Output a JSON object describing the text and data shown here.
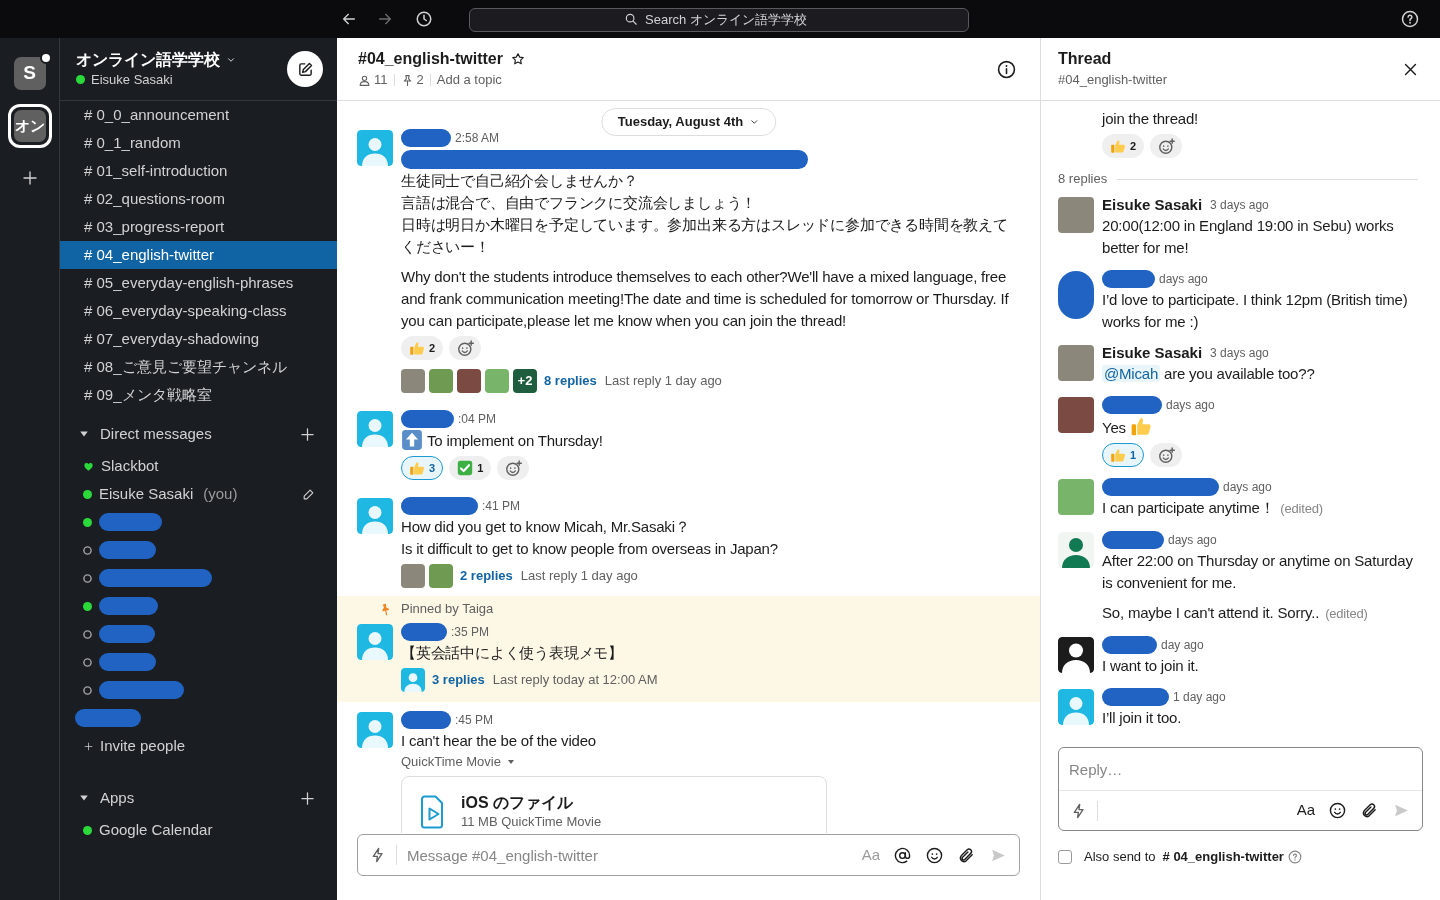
{
  "top_bar": {
    "search": {
      "placeholder": "Search オンライン語学学校"
    }
  },
  "workspace_rail": {
    "workspaces": [
      {
        "label": "S",
        "selected": false,
        "unread": true
      },
      {
        "label": "オン",
        "selected": true,
        "unread": false
      }
    ]
  },
  "sidebar": {
    "workspace_name": "オンライン語学学校",
    "user": {
      "name": "Eisuke Sasaki",
      "online": true
    },
    "channels": [
      {
        "label": "# 0_0_announcement",
        "selected": false
      },
      {
        "label": "# 0_1_random",
        "selected": false
      },
      {
        "label": "# 01_self-introduction",
        "selected": false
      },
      {
        "label": "# 02_questions-room",
        "selected": false
      },
      {
        "label": "# 03_progress-report",
        "selected": false
      },
      {
        "label": "# 04_english-twitter",
        "selected": true
      },
      {
        "label": "# 05_everyday-english-phrases",
        "selected": false
      },
      {
        "label": "# 06_everyday-speaking-class",
        "selected": false
      },
      {
        "label": "# 07_everyday-shadowing",
        "selected": false
      },
      {
        "label": "# 08_ご意見ご要望チャンネル",
        "selected": false
      },
      {
        "label": "# 09_メンタ戦略室",
        "selected": false
      }
    ],
    "sections": [
      {
        "title": "Direct messages",
        "expanded": true,
        "items": [
          {
            "kind": "bot",
            "name": "Slackbot"
          },
          {
            "kind": "self",
            "name": "Eisuke Sasaki",
            "suffix": "(you)",
            "online": true
          },
          {
            "kind": "member",
            "redacted": true,
            "online": true
          },
          {
            "kind": "member",
            "redacted": true,
            "online": false
          },
          {
            "kind": "member",
            "redacted": true,
            "online": false
          },
          {
            "kind": "member",
            "redacted": true,
            "online": true
          },
          {
            "kind": "member",
            "redacted": true,
            "online": false
          },
          {
            "kind": "member",
            "redacted": true,
            "online": false
          },
          {
            "kind": "member",
            "redacted": true,
            "online": false
          },
          {
            "kind": "member",
            "redacted": true
          }
        ],
        "footer": "Invite people"
      },
      {
        "title": "Apps",
        "expanded": true,
        "items": [
          {
            "kind": "app",
            "name": "Google Calendar",
            "online": true
          }
        ]
      }
    ]
  },
  "channel": {
    "name": "#04_english-twitter",
    "starred": false,
    "members": "11",
    "pins": "2",
    "topic": "Add a topic",
    "date": "Tuesday, August 4th",
    "messages": [
      {
        "avatar": {
          "kind": "default"
        },
        "author_redacted": true,
        "time": "2:58 AM",
        "mentions_redacted": true,
        "paragraphs": [
          {
            "lines": [
              "生徒同士で自己紹介会しませんか？",
              "言語は混合で、自由でフランクに交流会しましょう！",
              "日時は明日か木曜日を予定しています。参加出来る方はスレッドに参加できる時間を教えてくださいー！"
            ]
          },
          {
            "text": "Why don't the students introduce themselves to each other?We'll have a mixed language, free and frank communication meeting!The date and time is scheduled for tomorrow or Thursday. If you can participate,please let me know when you can join the thread!"
          }
        ],
        "reactions": [
          {
            "kind": "thumbs-up",
            "count": "2",
            "selected": false
          }
        ],
        "thread": {
          "avatars": [
            {
              "kind": "photo"
            },
            {
              "kind": "photo"
            },
            {
              "kind": "photo"
            },
            {
              "kind": "photo"
            }
          ],
          "more": "+2",
          "replies": "8 replies",
          "last_reply": "Last reply 1 day ago"
        }
      },
      {
        "avatar": {
          "kind": "default"
        },
        "author_redacted": true,
        "time": ":04 PM",
        "paragraphs": [
          {
            "emoji_before": {
              "kind": "up-arrow"
            },
            "text": "To implement on Thursday!"
          }
        ],
        "reactions": [
          {
            "kind": "thumbs-up",
            "count": "3",
            "selected": true
          },
          {
            "kind": "check-box",
            "count": "1",
            "selected": false
          }
        ]
      },
      {
        "avatar": {
          "kind": "default"
        },
        "author_redacted": true,
        "time": ":41 PM",
        "paragraphs": [
          {
            "lines": [
              "How did you get to know Micah, Mr.Sasaki？",
              "Is it difficult to get to know people from overseas in Japan?"
            ]
          }
        ],
        "thread": {
          "avatars": [
            {
              "kind": "photo"
            },
            {
              "kind": "photo"
            }
          ],
          "replies": "2 replies",
          "last_reply": "Last reply 1 day ago"
        }
      },
      {
        "pinned_by": "Pinned by Taiga",
        "avatar": {
          "kind": "default"
        },
        "author_redacted": true,
        "time": ":35 PM",
        "paragraphs": [
          {
            "text": "【英会話中によく使う表現メモ】"
          }
        ],
        "thread": {
          "avatars": [
            {
              "kind": "default"
            }
          ],
          "replies": "3 replies",
          "last_reply": "Last reply today at 12:00 AM"
        }
      },
      {
        "avatar": {
          "kind": "default"
        },
        "author_redacted": true,
        "time": ":45 PM",
        "paragraphs": [
          {
            "text": "I can't hear the be of the video"
          }
        ],
        "file": {
          "caption": "QuickTime Movie",
          "name": "iOS のファイル",
          "meta": "11 MB QuickTime Movie"
        }
      }
    ],
    "composer": {
      "placeholder": "Message #04_english-twitter",
      "format_label": "Aa",
      "format_active": false
    }
  },
  "thread": {
    "title": "Thread",
    "channel": "#04_english-twitter",
    "parent_tail": "join the thread!",
    "parent_reactions": [
      {
        "kind": "thumbs-up",
        "count": "2",
        "selected": false
      }
    ],
    "reply_count": "8 replies",
    "replies": [
      {
        "avatar": {
          "kind": "photo"
        },
        "author_redacted": false,
        "author": "Eisuke Sasaki",
        "time": "3 days ago",
        "paragraphs": [
          {
            "text": "20:00(12:00 in England 19:00 in Sebu) works better for me!"
          }
        ]
      },
      {
        "avatar": {
          "kind": "redacted"
        },
        "author_redacted": true,
        "time": "days ago",
        "paragraphs": [
          {
            "text": "I’d love to participate. I think 12pm (British time) works for me :)"
          }
        ]
      },
      {
        "avatar": {
          "kind": "photo"
        },
        "author_redacted": false,
        "author": "Eisuke Sasaki",
        "time": "3 days ago",
        "paragraphs": [
          {
            "mention": "@Micah",
            "text": "are you available too??"
          }
        ]
      },
      {
        "avatar": {
          "kind": "photo"
        },
        "author_redacted": true,
        "time": "days ago",
        "paragraphs": [
          {
            "text": "Yes",
            "emoji_after": {
              "kind": "thumbs-up"
            }
          }
        ],
        "reactions": [
          {
            "kind": "thumbs-up",
            "count": "1",
            "selected": true
          }
        ]
      },
      {
        "avatar": {
          "kind": "photo"
        },
        "author_redacted": true,
        "time": "days ago",
        "paragraphs": [
          {
            "text": "I can participate anytime！",
            "edited": "(edited)"
          }
        ]
      },
      {
        "avatar": {
          "kind": "silhouette-green"
        },
        "author_redacted": true,
        "time": "days ago",
        "paragraphs": [
          {
            "text": "After 22:00 on Thursday or anytime on Saturday is convenient for me."
          },
          {
            "text": "So, maybe I can't attend it. Sorry..",
            "edited": "(edited)"
          }
        ]
      },
      {
        "avatar": {
          "kind": "silhouette-dark"
        },
        "author_redacted": true,
        "time": "day ago",
        "paragraphs": [
          {
            "text": "I want to join it."
          }
        ]
      },
      {
        "avatar": {
          "kind": "default"
        },
        "author_redacted": true,
        "time": "1 day ago",
        "paragraphs": [
          {
            "text": "I’ll join it too."
          }
        ]
      }
    ],
    "reply_box": {
      "placeholder": "Reply…",
      "format_label": "Aa",
      "format_active": true
    },
    "also_send": {
      "checked": false,
      "label": "Also send to",
      "channel": "# 04_english-twitter"
    }
  }
}
